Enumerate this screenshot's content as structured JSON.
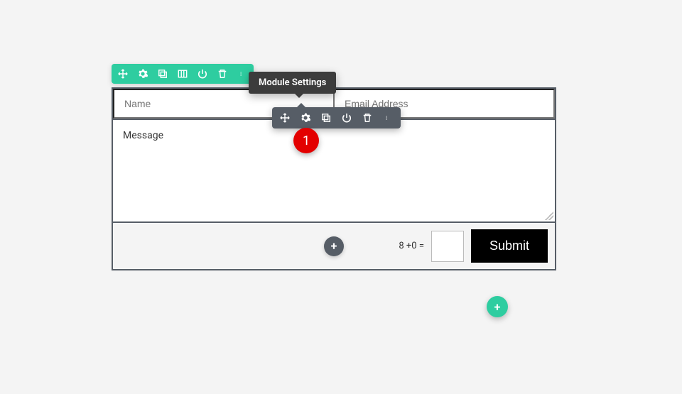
{
  "form": {
    "name_placeholder": "Name",
    "email_placeholder": "Email Address",
    "message_placeholder": "Message",
    "captcha_label": "8 +0 =",
    "submit_label": "Submit"
  },
  "tooltip": {
    "text": "Module Settings"
  },
  "annotation": {
    "step": "1"
  },
  "icons": {
    "plus": "+"
  }
}
